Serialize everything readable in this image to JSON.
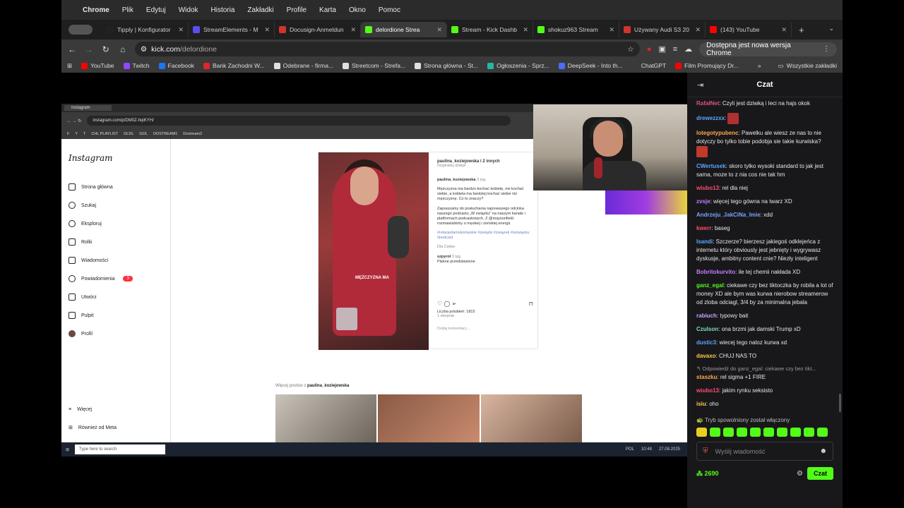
{
  "menubar": {
    "app": "Chrome",
    "items": [
      "Plik",
      "Edytuj",
      "Widok",
      "Historia",
      "Zakładki",
      "Profile",
      "Karta",
      "Okno",
      "Pomoc"
    ]
  },
  "tabs": [
    {
      "title": "Tipply | Konfigurator",
      "color": "#222222"
    },
    {
      "title": "StreamElements - M",
      "color": "#5b4ef0"
    },
    {
      "title": "Docusign-Anmeldun",
      "color": "#d0342c"
    },
    {
      "title": "delordione Strea",
      "color": "#53fc18",
      "active": true
    },
    {
      "title": "Stream - Kick Dashb",
      "color": "#53fc18"
    },
    {
      "title": "shokuz963 Stream",
      "color": "#53fc18"
    },
    {
      "title": "Używany Audi S3 20",
      "color": "#d0342c"
    },
    {
      "title": "(143) YouTube",
      "color": "#ff0000"
    }
  ],
  "toolbar": {
    "url_host": "kick.com",
    "url_path": "/delordione",
    "update_label": "Dostępna jest nowa wersja Chrome"
  },
  "bookmarks": [
    {
      "label": "YouTube",
      "color": "#ff0000"
    },
    {
      "label": "Twitch",
      "color": "#9146ff"
    },
    {
      "label": "Facebook",
      "color": "#1877f2"
    },
    {
      "label": "Bank Zachodni W...",
      "color": "#e0252c"
    },
    {
      "label": "Odebrane - firma...",
      "color": "#e0e0e0"
    },
    {
      "label": "Streetcom - Strefa...",
      "color": "#e0e0e0"
    },
    {
      "label": "Strona główna - St...",
      "color": "#e0e0e0"
    },
    {
      "label": "Ogłoszenia - Sprz...",
      "color": "#25b6a5"
    },
    {
      "label": "DeepSeek - Into th...",
      "color": "#4d6bfe"
    },
    {
      "label": "ChatGPT",
      "color": "#3a3a3a"
    },
    {
      "label": "Film Promujący Dr...",
      "color": "#ff0000"
    }
  ],
  "bookmarks_all": "Wszystkie zakładki",
  "stream": {
    "ig_tab": "Instagram",
    "ig_url": "instagram.com/p/DM0Z-hqiKYH/",
    "ig_bookmarks": [
      "F",
      "Y",
      "T",
      "CHL PLAYLIST",
      "OLDL",
      "GOL",
      "DOSTREAM1",
      "Dostream2"
    ],
    "ig_logo": "Instagram",
    "ig_nav": [
      "Strona główna",
      "Szukaj",
      "Eksploruj",
      "Rolki",
      "Wiadomości",
      "Powiadomienia",
      "Utwórz",
      "Pulpit",
      "Profil"
    ],
    "ig_badge": "3",
    "ig_bottom": [
      "Więcej",
      "Również od Meta"
    ],
    "post_user": "paulina_koziejowska i 2 innych",
    "post_sub": "Oryginalny dźwięk",
    "post_author": "paulina_koziejowska",
    "post_time": "3 tyg.",
    "post_text1": "Mężczyzna ma bardzo kochać kobietę, nie kochać siebie, a kobieta ma bardziej kochać siebie niż mężczyznę. Co to znaczy?",
    "post_text2": "Zapraszamy do posłuchania najnowszego odcinka naszego podcastu „W związku\" na naszym kanale i platformach podcastowych. Z @maysonfield rozmawialiśmy o męskiej i żeńskiej energii.",
    "post_tags": "#relacjedamskomęskie #związki #związek #wzwiązku #podcast",
    "post_translate": "Dla Ciebie",
    "comment_user": "szpyrol",
    "comment_time": "3 tyg.",
    "comment_text": "Piękne przedstawione",
    "likes": "Liczba polubień: 1815",
    "date": "1 sierpnia",
    "add_comment": "Dodaj komentarz...",
    "caption": "MĘŻCZYZNA MA",
    "more_posts_prefix": "Więcej postów z",
    "more_posts_user": "paulina_koziejowska",
    "taskbar_search": "Type here to search",
    "taskbar_lang": "POL",
    "taskbar_time": "10:48",
    "taskbar_date": "27.08.2025"
  },
  "chat": {
    "title": "Czat",
    "messages": [
      {
        "nick": "RafałNet",
        "color": "#e0507a",
        "text": "Czyli jest dziwką i leci na hajs okok"
      },
      {
        "nick": "drewezzxx",
        "color": "#5aa7ff",
        "text": "",
        "emote": "#b03030"
      },
      {
        "nick": "lotegotypubenc",
        "color": "#ffa94d",
        "text": "Pawelku ale wiesz ze nas to nie dotyczy bo tylko tobie podobja sie takie kurwiska?",
        "emote": "#c0392b"
      },
      {
        "nick": "CWertusek",
        "color": "#5aa7ff",
        "text": "skoro tylko wysoki standard to jak jest sama, moze to z nia cos nie tak hm"
      },
      {
        "nick": "wiubo13",
        "color": "#ff4d6d",
        "text": "rel dla niej"
      },
      {
        "nick": "zvsje",
        "color": "#c77dff",
        "text": "więcej tego gówna na twarz XD"
      },
      {
        "nick": "Andrzeju_JakCiNa_Imie",
        "color": "#7aa2ff",
        "text": "xdd"
      },
      {
        "nick": "kwerr",
        "color": "#ff4d6d",
        "text": "baseg"
      },
      {
        "nick": "Isandi",
        "color": "#5aa7ff",
        "text": "Szczerze? bierzesz jakiegoś odklejeńca z internetu który obviously jest jebnięty i wygrywasz dyskusje, ambitny content cnie? Niezły inteligent"
      },
      {
        "nick": "Bobritokurvito",
        "color": "#c77dff",
        "text": "ile tej chemii nakłada XD"
      },
      {
        "nick": "ganz_egal",
        "color": "#53fc18",
        "text": "ciekawe czy bez tiktoczka by robila a lot of money XD ale bym was kurwa nierobow streamerow od zloba odciagl, 3/4 by za minimalna jebala"
      },
      {
        "nick": "rabiuch",
        "color": "#c8a2ff",
        "text": "typowy bait"
      },
      {
        "nick": "Czulson",
        "color": "#7fe0c0",
        "text": "ona brzmi jak damski Trump xD"
      },
      {
        "nick": "dustic3",
        "color": "#5aa7ff",
        "text": "wiecej tego naloz kurwa xd"
      },
      {
        "nick": "davaxo",
        "color": "#ffcc4d",
        "text": "CHUJ NAS TO"
      },
      {
        "nick": "staszku",
        "color": "#ffa94d",
        "text": "rel sigma +1 FIRE",
        "reply": "Odpowiedź do ganz_egal: ciekawe czy bez tikt..."
      },
      {
        "nick": "wiubo13",
        "color": "#ff4d6d",
        "text": "jakim rynku seksisto"
      },
      {
        "nick": "isiu",
        "color": "#ffcc4d",
        "text": "oho"
      }
    ],
    "slow_mode": "Tryb spowolniony został włączony",
    "input_placeholder": "Wyślij wiadomość",
    "points": "2690",
    "send_label": "Czat"
  }
}
